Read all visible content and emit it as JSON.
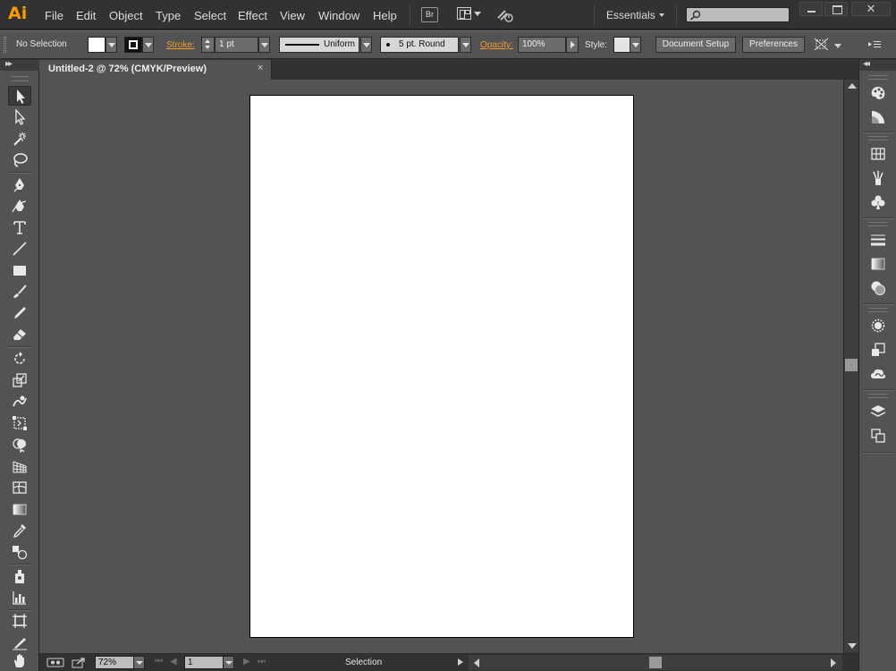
{
  "app": {
    "logo": "Ai",
    "accent": "#ff9a00"
  },
  "menu": [
    "File",
    "Edit",
    "Object",
    "Type",
    "Select",
    "Effect",
    "View",
    "Window",
    "Help"
  ],
  "topbar": {
    "bridge_label": "Br",
    "workspace": "Essentials",
    "search_placeholder": ""
  },
  "control": {
    "selection_label": "No Selection",
    "stroke_label": "Stroke:",
    "stroke_weight": "1 pt",
    "profile": "Uniform",
    "brush": "5 pt. Round",
    "opacity_label": "Opacity:",
    "opacity_value": "100%",
    "style_label": "Style:",
    "document_setup": "Document Setup",
    "preferences": "Preferences"
  },
  "document": {
    "tab_title": "Untitled-2 @ 72% (CMYK/Preview)",
    "close_glyph": "×"
  },
  "status": {
    "zoom": "72%",
    "artboard": "1",
    "current_tool": "Selection"
  },
  "icons": {
    "tools": [
      "selection-tool",
      "direct-selection-tool",
      "magic-wand-tool",
      "lasso-tool",
      "pen-tool",
      "curvature-tool",
      "type-tool",
      "line-segment-tool",
      "rectangle-tool",
      "paintbrush-tool",
      "pencil-tool",
      "eraser-tool",
      "rotate-tool",
      "scale-tool",
      "warp-tool",
      "free-transform-tool",
      "shape-builder-tool",
      "perspective-grid-tool",
      "mesh-tool",
      "gradient-tool",
      "eyedropper-tool",
      "blend-tool",
      "symbol-sprayer-tool",
      "column-graph-tool",
      "artboard-tool",
      "slice-tool",
      "hand-tool"
    ],
    "dock": [
      "color-panel",
      "color-guide-panel",
      "swatches-panel",
      "brushes-panel",
      "symbols-panel",
      "stroke-panel",
      "gradient-panel",
      "transparency-panel",
      "appearance-panel",
      "graphic-styles-panel",
      "cc-libraries-panel",
      "layers-panel",
      "artboards-panel"
    ]
  }
}
